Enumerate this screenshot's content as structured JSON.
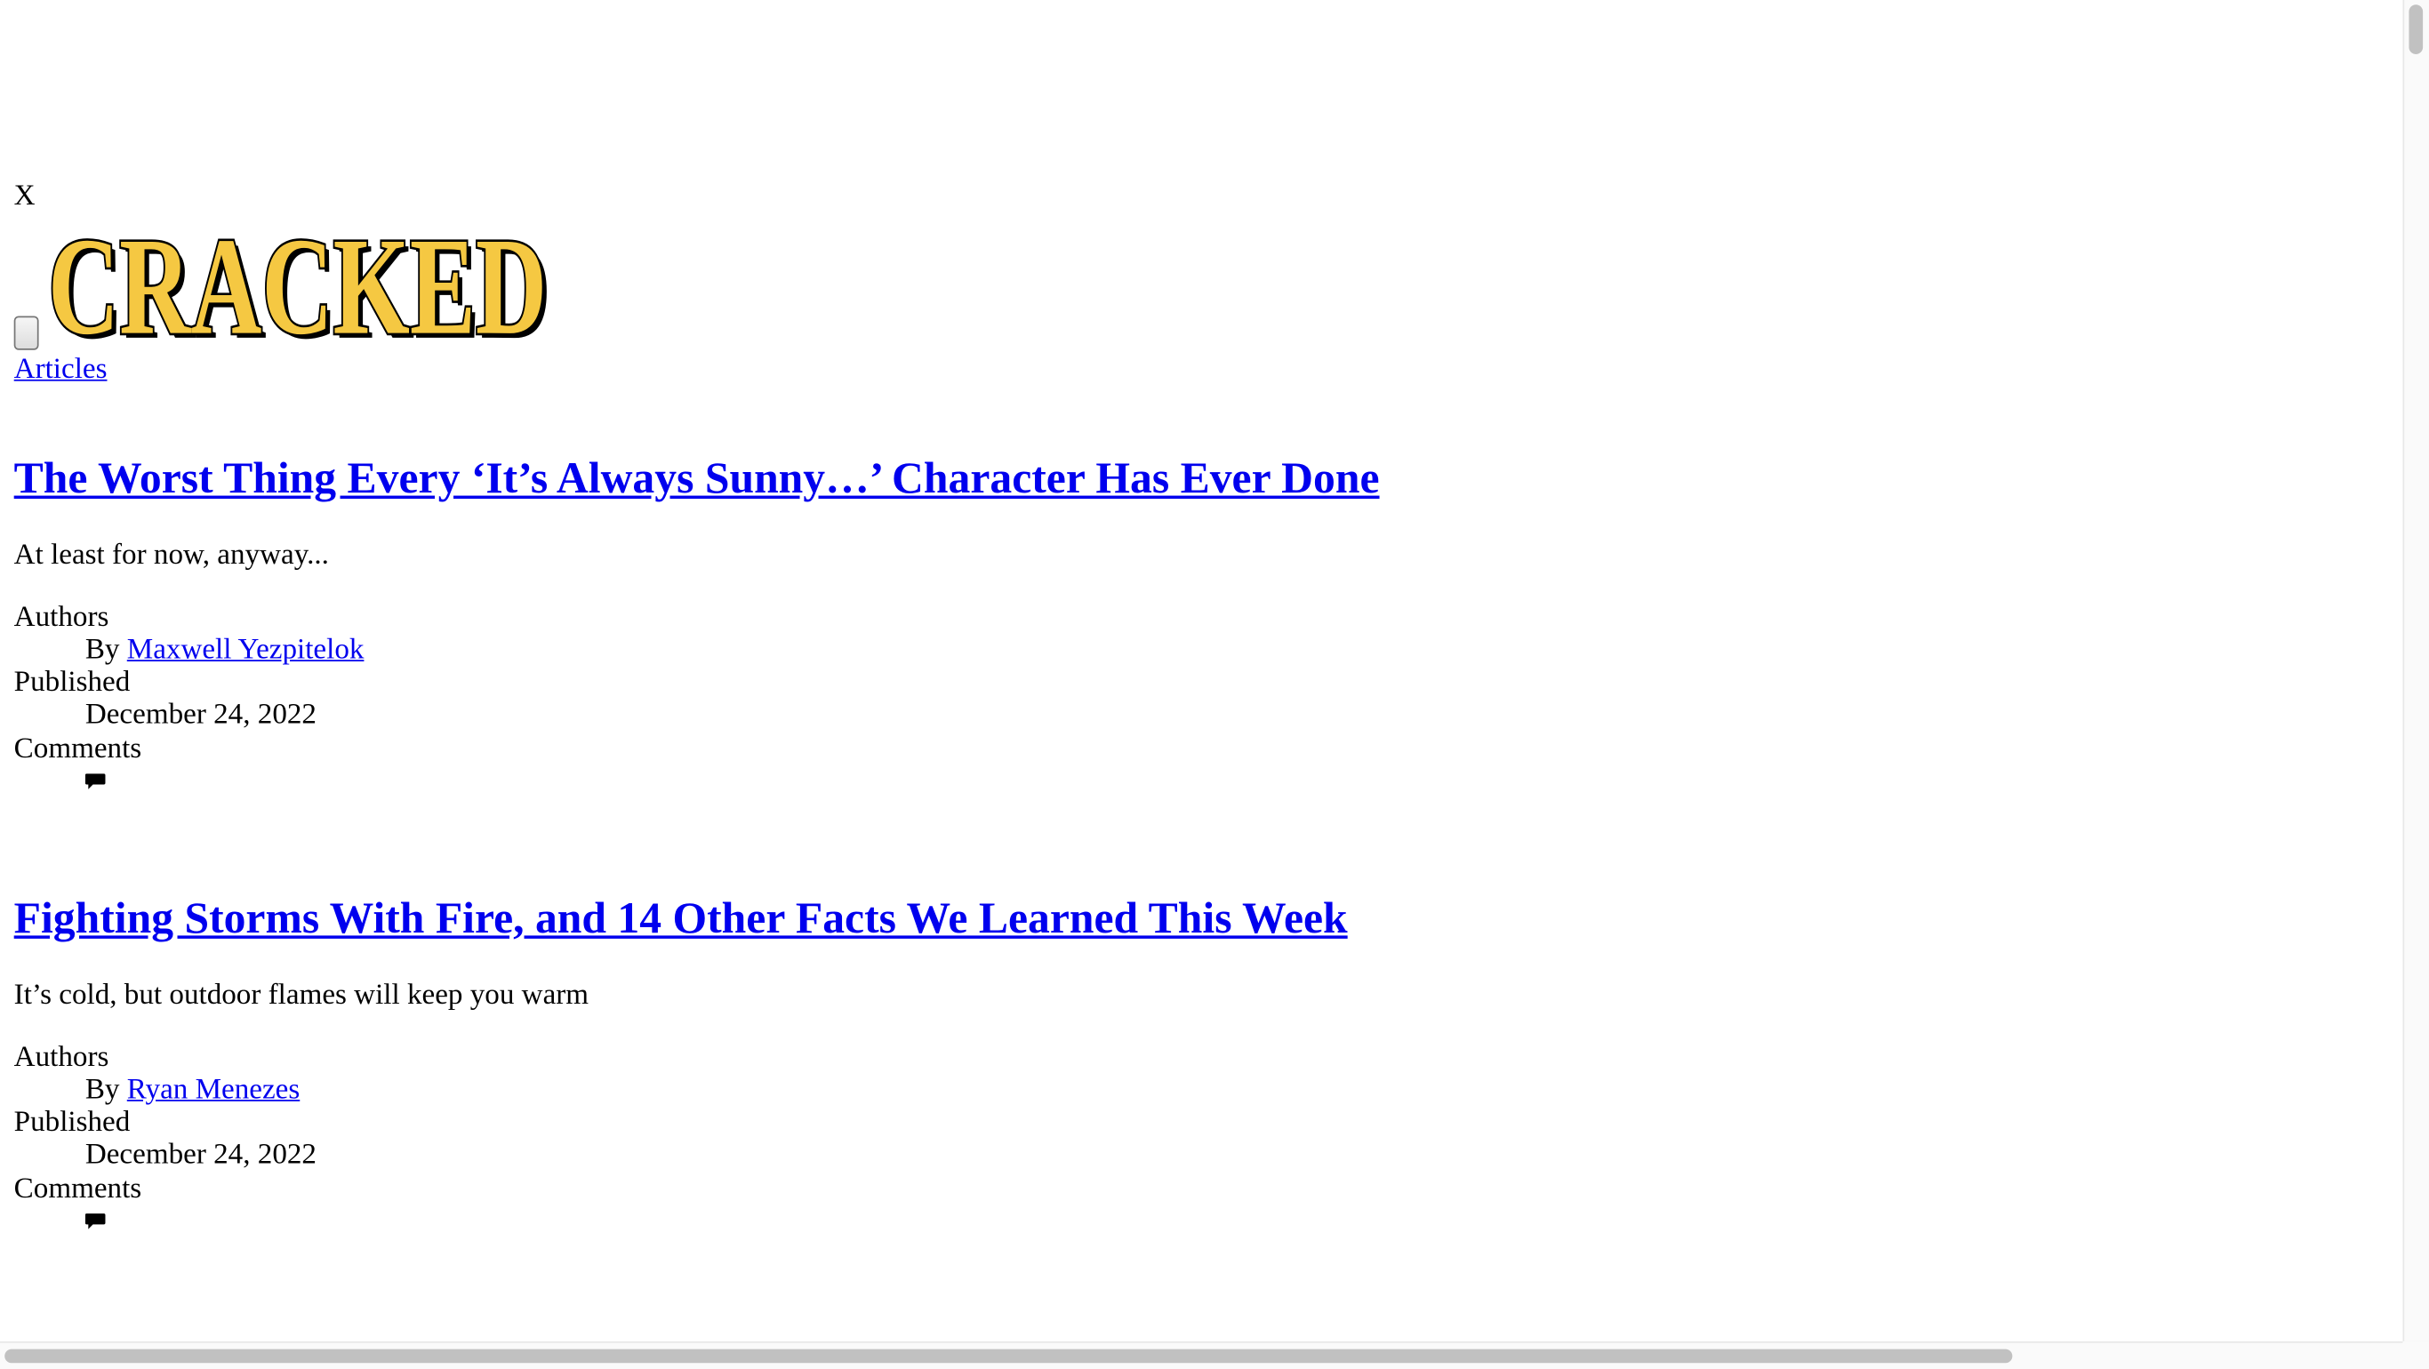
{
  "header": {
    "close_label": "X",
    "logo_text": "CRACKED",
    "nav_articles_label": "Articles"
  },
  "articles": [
    {
      "title": "The Worst Thing Every ‘It’s Always Sunny…’ Character Has Ever Done",
      "subtitle": "At least for now, anyway...",
      "authors_label": "Authors",
      "by_prefix": "By",
      "author": "Maxwell Yezpitelok",
      "published_label": "Published",
      "date": "December 24, 2022",
      "comments_label": "Comments",
      "comments_icon": "comment-bubble-icon"
    },
    {
      "title": "Fighting Storms With Fire, and 14 Other Facts We Learned This Week",
      "subtitle": "It’s cold, but outdoor flames will keep you warm",
      "authors_label": "Authors",
      "by_prefix": "By",
      "author": "Ryan Menezes",
      "published_label": "Published",
      "date": "December 24, 2022",
      "comments_label": "Comments",
      "comments_icon": "comment-bubble-icon"
    }
  ],
  "colors": {
    "link": "#0000ee",
    "logo_fill": "#f5c842",
    "logo_outline": "#000000"
  }
}
